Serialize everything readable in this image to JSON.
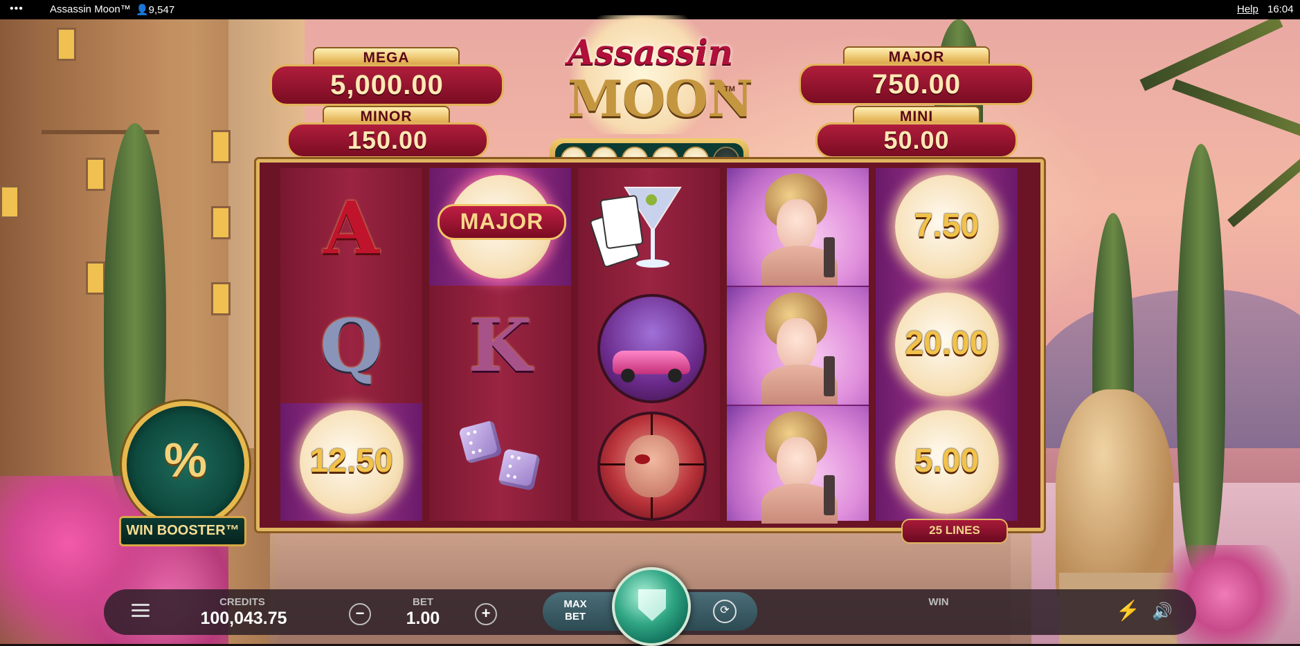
{
  "topbar": {
    "menu": "•••",
    "title": "Assassin Moon™",
    "players": "👤9,547",
    "help": "Help",
    "time": "16:04"
  },
  "jackpots": {
    "mega": {
      "label": "MEGA",
      "value": "5,000.00"
    },
    "minor": {
      "label": "MINOR",
      "value": "150.00"
    },
    "major": {
      "label": "MAJOR",
      "value": "750.00"
    },
    "mini": {
      "label": "MINI",
      "value": "50.00"
    }
  },
  "logo": {
    "line1": "Assassin",
    "line2": "MOON",
    "tm": "TM"
  },
  "moon_progress": {
    "filled": 5,
    "total": 6
  },
  "reels": {
    "r1": {
      "top": "A",
      "middle": "Q",
      "bottom": "12.50"
    },
    "r2": {
      "top_badge": "MAJOR",
      "middle": "K"
    },
    "r3": {
      "card": "♠"
    },
    "r5": {
      "top": "7.50",
      "middle": "20.00",
      "bottom": "5.00"
    }
  },
  "lines": "25 LINES",
  "win_booster": {
    "symbol": "%",
    "label": "WIN BOOSTER™"
  },
  "bottom": {
    "credits_label": "CREDITS",
    "credits_value": "100,043.75",
    "bet_label": "BET",
    "bet_value": "1.00",
    "minus": "−",
    "plus": "+",
    "maxbet_label": "MAX BET",
    "win_label": "WIN",
    "bolt_icon": "⚡",
    "speaker_icon": "🔊",
    "autoplay_icon": "⟳"
  },
  "colors": {
    "jackpot_red": "#9a1634",
    "gold": "#e3b35a",
    "spin_green": "#2fa583"
  }
}
